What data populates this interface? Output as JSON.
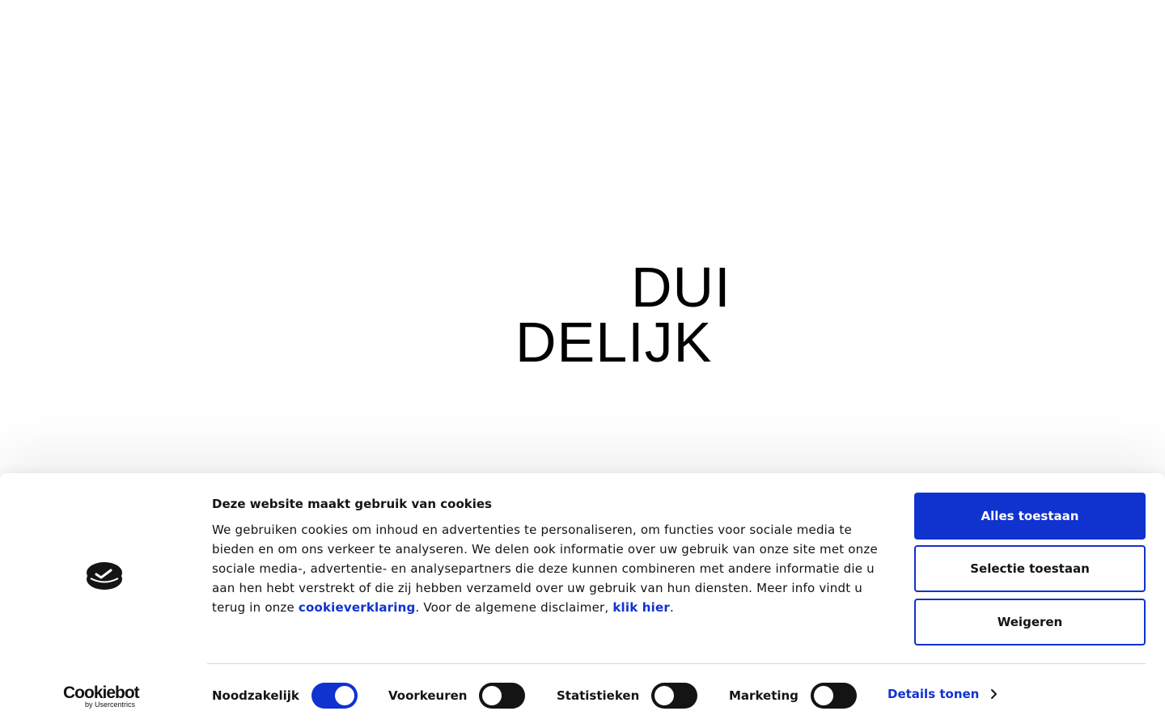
{
  "hero": {
    "logo_line1": "DUI",
    "logo_line2": "DELIJK"
  },
  "banner": {
    "brand": {
      "icon": "cookie-icon",
      "wordmark": "Cookiebot",
      "wordmark_sub": "by Usercentrics"
    },
    "title": "Deze website maakt gebruik van cookies",
    "body_before_link1": "We gebruiken cookies om inhoud en advertenties te personaliseren, om functies voor sociale media te bieden en om ons verkeer te analyseren. We delen ook informatie over uw gebruik van onze site met onze sociale media-, advertentie- en analysepartners die deze kunnen combineren met andere informatie die u aan hen hebt verstrekt of die zij hebben verzameld over uw gebruik van hun diensten. Meer info vindt u terug in onze ",
    "link1": "cookieverklaring",
    "body_between": ". Voor de algemene disclaimer, ",
    "link2": "klik hier",
    "body_after": ".",
    "buttons": {
      "allow_all": "Alles toestaan",
      "allow_selection": "Selectie toestaan",
      "deny": "Weigeren"
    },
    "toggles": [
      {
        "label": "Noodzakelijk",
        "checked": true
      },
      {
        "label": "Voorkeuren",
        "checked": false
      },
      {
        "label": "Statistieken",
        "checked": false
      },
      {
        "label": "Marketing",
        "checked": false
      }
    ],
    "details_label": "Details tonen",
    "details_icon": "chevron-right-icon"
  },
  "colors": {
    "accent": "#1032cf",
    "text": "#141414",
    "background": "#ffffff"
  }
}
